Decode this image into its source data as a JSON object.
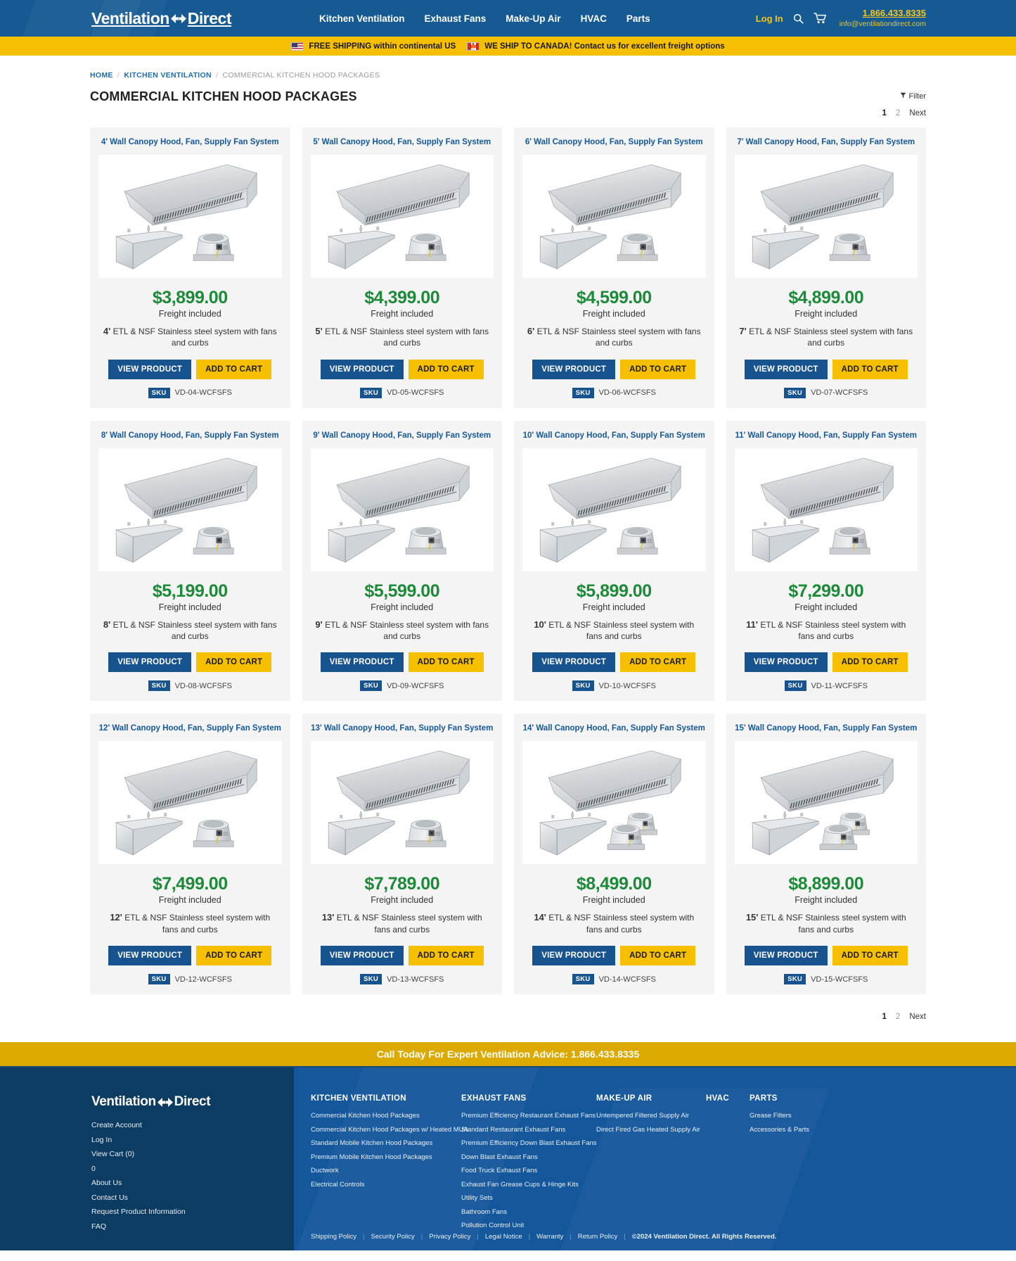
{
  "header": {
    "logo_text_1": "Ventilation",
    "logo_text_2": "Direct",
    "nav": [
      {
        "label": "Kitchen Ventilation"
      },
      {
        "label": "Exhaust Fans"
      },
      {
        "label": "Make-Up Air"
      },
      {
        "label": "HVAC"
      },
      {
        "label": "Parts"
      }
    ],
    "login_label": "Log In",
    "search_icon": "search-icon",
    "cart_icon": "cart-icon",
    "phone": "1.866.433.8335",
    "email": "info@ventilationdirect.com"
  },
  "shipping_banner": {
    "us_text": "FREE SHIPPING within continental US",
    "ca_text": "WE SHIP TO CANADA! Contact us for excellent freight options"
  },
  "breadcrumb": {
    "home": "HOME",
    "parent": "KITCHEN VENTILATION",
    "current": "COMMERCIAL KITCHEN HOOD PACKAGES"
  },
  "page_title": "COMMERCIAL KITCHEN HOOD PACKAGES",
  "controls": {
    "filter_label": "Filter",
    "pagination": {
      "page1": "1",
      "page2": "2",
      "next": "Next"
    }
  },
  "card_labels": {
    "freight": "Freight included",
    "view_product": "VIEW PRODUCT",
    "add_to_cart": "ADD TO CART",
    "sku_badge": "SKU"
  },
  "products": [
    {
      "title": "4' Wall Canopy Hood, Fan, Supply Fan System",
      "price": "$3,899.00",
      "size": "4'",
      "desc": "ETL & NSF Stainless steel system with fans and curbs",
      "sku": "VD-04-WCFSFS",
      "fans": 1
    },
    {
      "title": "5' Wall Canopy Hood, Fan, Supply Fan System",
      "price": "$4,399.00",
      "size": "5'",
      "desc": "ETL & NSF Stainless steel system with fans and curbs",
      "sku": "VD-05-WCFSFS",
      "fans": 1
    },
    {
      "title": "6' Wall Canopy Hood, Fan, Supply Fan System",
      "price": "$4,599.00",
      "size": "6'",
      "desc": "ETL & NSF Stainless steel system with fans and curbs",
      "sku": "VD-06-WCFSFS",
      "fans": 1
    },
    {
      "title": "7' Wall Canopy Hood, Fan, Supply Fan System",
      "price": "$4,899.00",
      "size": "7'",
      "desc": "ETL & NSF Stainless steel system with fans and curbs",
      "sku": "VD-07-WCFSFS",
      "fans": 1
    },
    {
      "title": "8' Wall Canopy Hood, Fan, Supply Fan System",
      "price": "$5,199.00",
      "size": "8'",
      "desc": "ETL & NSF Stainless steel system with fans and curbs",
      "sku": "VD-08-WCFSFS",
      "fans": 1
    },
    {
      "title": "9' Wall Canopy Hood, Fan, Supply Fan System",
      "price": "$5,599.00",
      "size": "9'",
      "desc": "ETL & NSF Stainless steel system with fans and curbs",
      "sku": "VD-09-WCFSFS",
      "fans": 1
    },
    {
      "title": "10' Wall Canopy Hood, Fan, Supply Fan System",
      "price": "$5,899.00",
      "size": "10'",
      "desc": "ETL & NSF Stainless steel system with fans and curbs",
      "sku": "VD-10-WCFSFS",
      "fans": 1
    },
    {
      "title": "11' Wall Canopy Hood, Fan, Supply Fan System",
      "price": "$7,299.00",
      "size": "11'",
      "desc": "ETL & NSF Stainless steel system with fans and curbs",
      "sku": "VD-11-WCFSFS",
      "fans": 1
    },
    {
      "title": "12' Wall Canopy Hood, Fan, Supply Fan System",
      "price": "$7,499.00",
      "size": "12'",
      "desc": "ETL & NSF Stainless steel system with fans and curbs",
      "sku": "VD-12-WCFSFS",
      "fans": 1
    },
    {
      "title": "13' Wall Canopy Hood, Fan, Supply Fan System",
      "price": "$7,789.00",
      "size": "13'",
      "desc": "ETL & NSF Stainless steel system with fans and curbs",
      "sku": "VD-13-WCFSFS",
      "fans": 1
    },
    {
      "title": "14' Wall Canopy Hood, Fan, Supply Fan System",
      "price": "$8,499.00",
      "size": "14'",
      "desc": "ETL & NSF Stainless steel system with fans and curbs",
      "sku": "VD-14-WCFSFS",
      "fans": 2
    },
    {
      "title": "15' Wall Canopy Hood, Fan, Supply Fan System",
      "price": "$8,899.00",
      "size": "15'",
      "desc": "ETL & NSF Stainless steel system with fans and curbs",
      "sku": "VD-15-WCFSFS",
      "fans": 2
    }
  ],
  "call_bar": "Call Today For Expert Ventilation Advice: 1.866.433.8335",
  "footer": {
    "logo_text_1": "Ventilation",
    "logo_text_2": "Direct",
    "account_links": [
      "Create Account",
      "Log In",
      "View Cart (0)",
      "0",
      "About Us",
      "Contact Us",
      "Request Product Information",
      "FAQ"
    ],
    "columns": [
      {
        "heading": "KITCHEN VENTILATION",
        "links": [
          "Commercial Kitchen Hood Packages",
          "Commercial Kitchen Hood Packages w/ Heated MUA",
          "Standard Mobile Kitchen Hood Packages",
          "Premium Mobile Kitchen Hood Packages",
          "Ductwork",
          "Electrical Controls"
        ]
      },
      {
        "heading": "EXHAUST FANS",
        "links": [
          "Premium Efficiency Restaurant Exhaust Fans",
          "Standard Restaurant Exhaust Fans",
          "Premium Efficiency Down Blast Exhaust Fans",
          "Down Blast Exhaust Fans",
          "Food Truck Exhaust Fans",
          "Exhaust Fan Grease Cups & Hinge Kits",
          "Utility Sets",
          "Bathroom Fans",
          "Pollution Control Unit"
        ]
      },
      {
        "heading": "MAKE-UP AIR",
        "links": [
          "Untempered Filtered Supply Air",
          "Direct Fired Gas Heated Supply Air"
        ]
      },
      {
        "heading": "HVAC",
        "links": []
      },
      {
        "heading": "PARTS",
        "links": [
          "Grease Filters",
          "Accessories & Parts"
        ]
      }
    ],
    "legal_links": [
      "Shipping Policy",
      "Security Policy",
      "Privacy Policy",
      "Legal Notice",
      "Warranty",
      "Return Policy"
    ],
    "copyright": "©2024 Ventilation Direct. All Rights Reserved."
  },
  "colors": {
    "header_blue": "#155a93",
    "accent_yellow": "#f6c000",
    "price_green": "#1d8a3a",
    "link_blue": "#15579b",
    "footer_dark": "#0d3c63"
  }
}
